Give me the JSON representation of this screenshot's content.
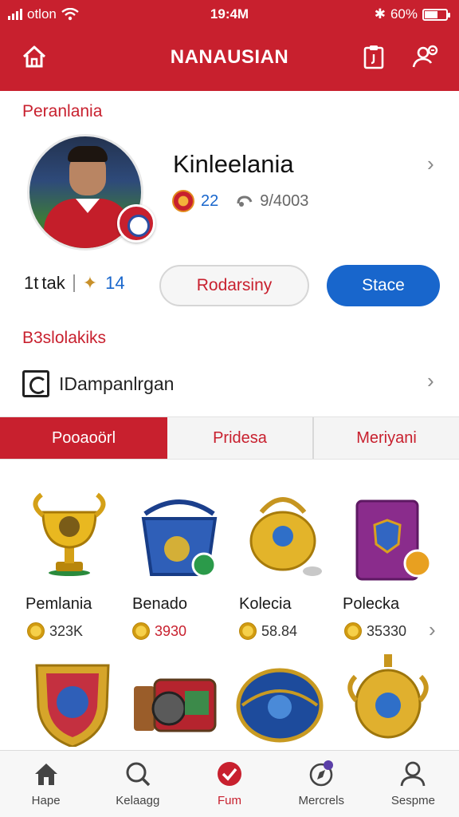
{
  "status_bar": {
    "carrier": "otlon",
    "time": "19:4M",
    "battery": "60%",
    "battery_level": 0.6
  },
  "header": {
    "title": "NANAUSIAN",
    "home_icon": "home-icon",
    "clipboard_icon": "clipboard-icon",
    "user_settings_icon": "user-settings-icon",
    "accent_color": "#c8202e"
  },
  "profile": {
    "section_label": "Peranlania",
    "name": "Kinleelania",
    "level": "22",
    "points": "9/4003",
    "stat_a": "1t",
    "stat_a_text": "tak",
    "stat_b": "14",
    "button_secondary": "Rodarsiny",
    "button_primary": "Stace",
    "primary_color": "#1866cc"
  },
  "collections": {
    "section_label": "B3slolakiks",
    "row_label": "IDampanlrgan"
  },
  "tabs": [
    {
      "label": "Pooaoörl",
      "active": true
    },
    {
      "label": "Pridesa",
      "active": false
    },
    {
      "label": "Meriyani",
      "active": false
    }
  ],
  "items": [
    {
      "name": "Pemlania",
      "price": "323K",
      "icon": "gold-trophy-icon"
    },
    {
      "name": "Benado",
      "price": "3930",
      "icon": "blue-bucket-icon"
    },
    {
      "name": "Kolecia",
      "price": "58.84",
      "icon": "gold-kettle-icon"
    },
    {
      "name": "Polecka",
      "price": "35330",
      "icon": "purple-canister-icon"
    }
  ],
  "items_row2": [
    {
      "icon": "shield-crest-icon"
    },
    {
      "icon": "treasure-chest-icon"
    },
    {
      "icon": "blue-emblem-icon"
    },
    {
      "icon": "gold-urn-icon"
    }
  ],
  "bottom_nav": [
    {
      "label": "Hape",
      "icon": "home-icon",
      "active": false
    },
    {
      "label": "Kelaagg",
      "icon": "search-icon",
      "active": false
    },
    {
      "label": "Fum",
      "icon": "check-badge-icon",
      "active": true
    },
    {
      "label": "Mercrels",
      "icon": "compass-icon",
      "active": false
    },
    {
      "label": "Sespme",
      "icon": "profile-icon",
      "active": false
    }
  ]
}
